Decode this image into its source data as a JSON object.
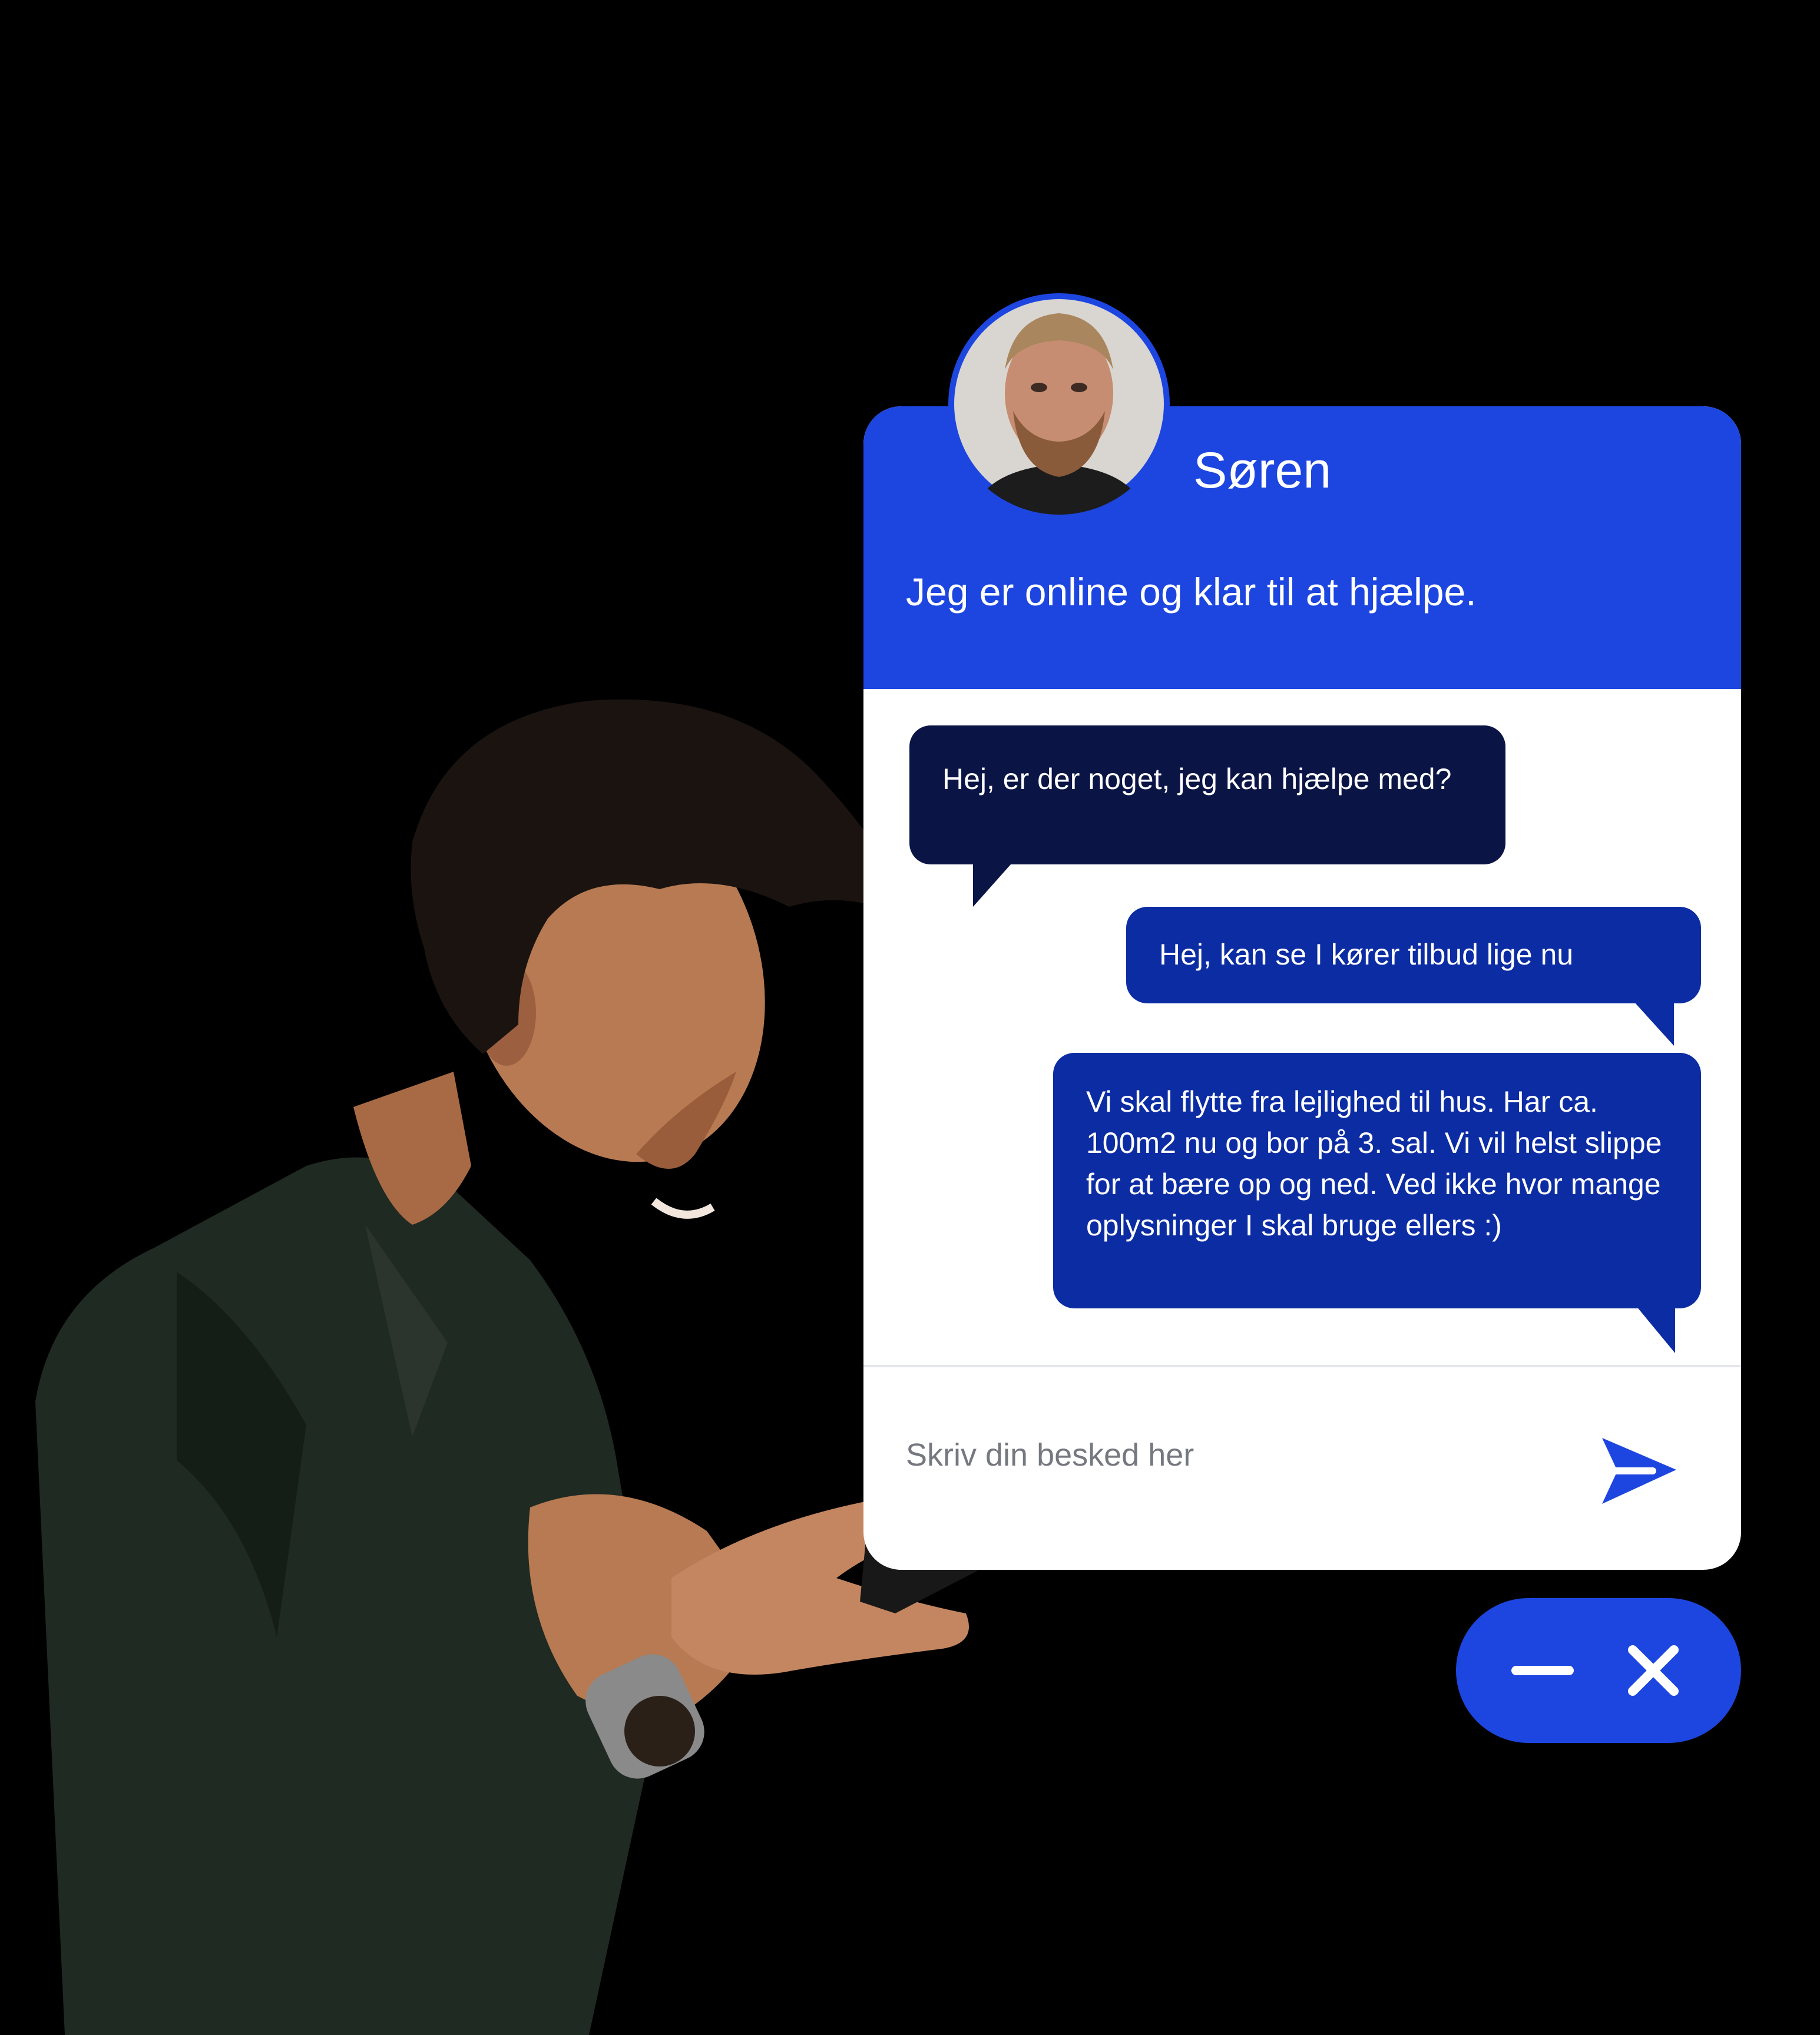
{
  "agent": {
    "name": "Søren",
    "status": "Jeg er online og klar til at hjælpe.",
    "avatar_icon": "agent-photo-icon"
  },
  "messages": [
    {
      "from": "agent",
      "text": "Hej, er der noget, jeg kan hjælpe med?"
    },
    {
      "from": "user",
      "text": "Hej, kan se I kører tilbud lige nu"
    },
    {
      "from": "user",
      "text": "Vi skal flytte fra lejlighed til hus. Har ca. 100m2 nu og bor på 3. sal. Vi vil helst slippe for at bære op og ned. Ved ikke hvor mange oplysninger I skal bruge ellers :)"
    }
  ],
  "composer": {
    "placeholder": "Skriv din besked her",
    "send_icon": "send-icon"
  },
  "window_controls": {
    "minimize_icon": "minimize-icon",
    "close_icon": "close-icon"
  },
  "colors": {
    "background": "#000000",
    "accent": "#1d46e0",
    "agent_bubble": "#0a1445",
    "user_bubble": "#0c2ca3",
    "panel": "#ffffff"
  }
}
